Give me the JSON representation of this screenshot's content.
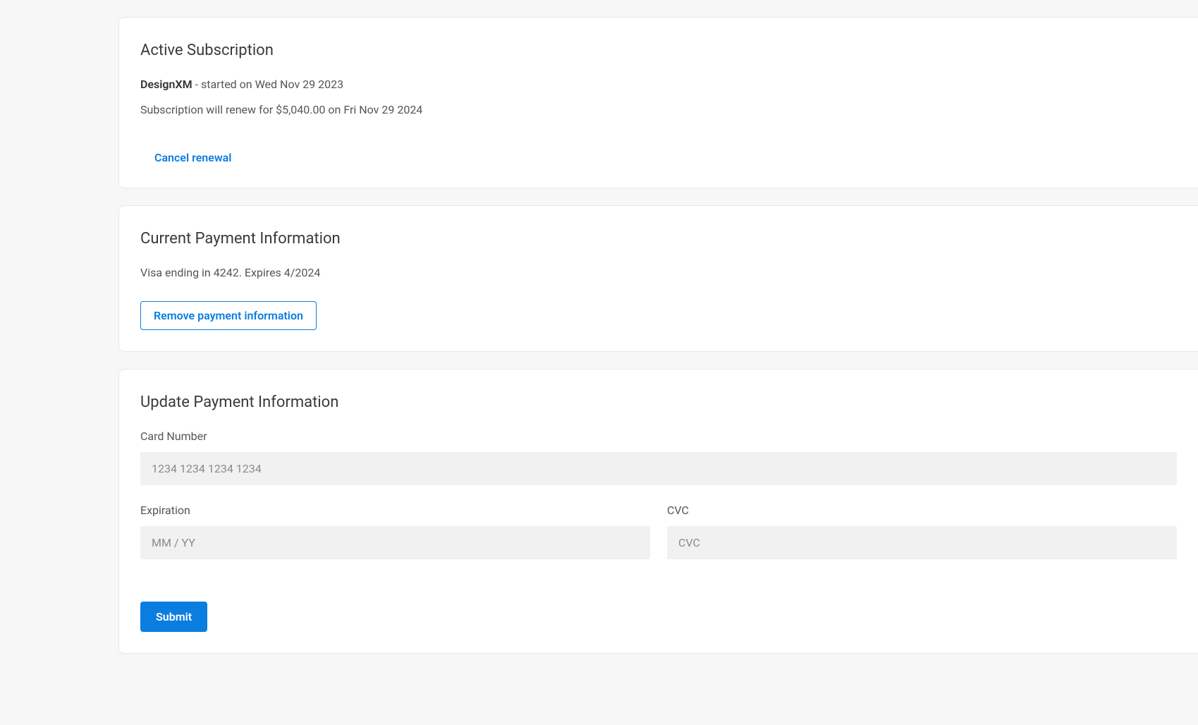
{
  "subscription": {
    "title": "Active Subscription",
    "plan_name": "DesignXM",
    "started_text": " - started on Wed Nov 29 2023",
    "renewal_text": "Subscription will renew for $5,040.00 on Fri Nov 29 2024",
    "cancel_label": "Cancel renewal"
  },
  "current_payment": {
    "title": "Current Payment Information",
    "summary": "Visa ending in 4242. Expires 4/2024",
    "remove_label": "Remove payment information"
  },
  "update_payment": {
    "title": "Update Payment Information",
    "card_number": {
      "label": "Card Number",
      "placeholder": "1234 1234 1234 1234",
      "value": ""
    },
    "expiration": {
      "label": "Expiration",
      "placeholder": "MM / YY",
      "value": ""
    },
    "cvc": {
      "label": "CVC",
      "placeholder": "CVC",
      "value": ""
    },
    "submit_label": "Submit"
  }
}
